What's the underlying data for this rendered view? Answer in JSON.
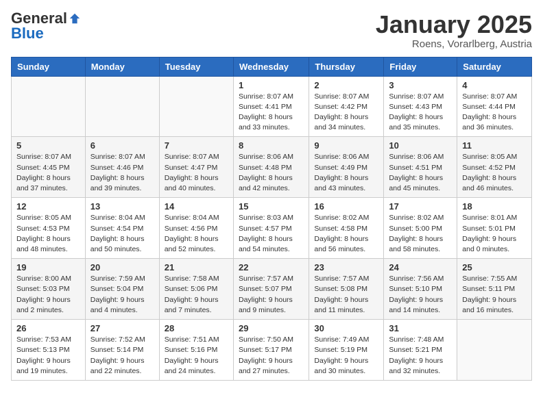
{
  "header": {
    "logo_general": "General",
    "logo_blue": "Blue",
    "title": "January 2025",
    "location": "Roens, Vorarlberg, Austria"
  },
  "weekdays": [
    "Sunday",
    "Monday",
    "Tuesday",
    "Wednesday",
    "Thursday",
    "Friday",
    "Saturday"
  ],
  "weeks": [
    [
      {
        "day": "",
        "info": ""
      },
      {
        "day": "",
        "info": ""
      },
      {
        "day": "",
        "info": ""
      },
      {
        "day": "1",
        "info": "Sunrise: 8:07 AM\nSunset: 4:41 PM\nDaylight: 8 hours\nand 33 minutes."
      },
      {
        "day": "2",
        "info": "Sunrise: 8:07 AM\nSunset: 4:42 PM\nDaylight: 8 hours\nand 34 minutes."
      },
      {
        "day": "3",
        "info": "Sunrise: 8:07 AM\nSunset: 4:43 PM\nDaylight: 8 hours\nand 35 minutes."
      },
      {
        "day": "4",
        "info": "Sunrise: 8:07 AM\nSunset: 4:44 PM\nDaylight: 8 hours\nand 36 minutes."
      }
    ],
    [
      {
        "day": "5",
        "info": "Sunrise: 8:07 AM\nSunset: 4:45 PM\nDaylight: 8 hours\nand 37 minutes."
      },
      {
        "day": "6",
        "info": "Sunrise: 8:07 AM\nSunset: 4:46 PM\nDaylight: 8 hours\nand 39 minutes."
      },
      {
        "day": "7",
        "info": "Sunrise: 8:07 AM\nSunset: 4:47 PM\nDaylight: 8 hours\nand 40 minutes."
      },
      {
        "day": "8",
        "info": "Sunrise: 8:06 AM\nSunset: 4:48 PM\nDaylight: 8 hours\nand 42 minutes."
      },
      {
        "day": "9",
        "info": "Sunrise: 8:06 AM\nSunset: 4:49 PM\nDaylight: 8 hours\nand 43 minutes."
      },
      {
        "day": "10",
        "info": "Sunrise: 8:06 AM\nSunset: 4:51 PM\nDaylight: 8 hours\nand 45 minutes."
      },
      {
        "day": "11",
        "info": "Sunrise: 8:05 AM\nSunset: 4:52 PM\nDaylight: 8 hours\nand 46 minutes."
      }
    ],
    [
      {
        "day": "12",
        "info": "Sunrise: 8:05 AM\nSunset: 4:53 PM\nDaylight: 8 hours\nand 48 minutes."
      },
      {
        "day": "13",
        "info": "Sunrise: 8:04 AM\nSunset: 4:54 PM\nDaylight: 8 hours\nand 50 minutes."
      },
      {
        "day": "14",
        "info": "Sunrise: 8:04 AM\nSunset: 4:56 PM\nDaylight: 8 hours\nand 52 minutes."
      },
      {
        "day": "15",
        "info": "Sunrise: 8:03 AM\nSunset: 4:57 PM\nDaylight: 8 hours\nand 54 minutes."
      },
      {
        "day": "16",
        "info": "Sunrise: 8:02 AM\nSunset: 4:58 PM\nDaylight: 8 hours\nand 56 minutes."
      },
      {
        "day": "17",
        "info": "Sunrise: 8:02 AM\nSunset: 5:00 PM\nDaylight: 8 hours\nand 58 minutes."
      },
      {
        "day": "18",
        "info": "Sunrise: 8:01 AM\nSunset: 5:01 PM\nDaylight: 9 hours\nand 0 minutes."
      }
    ],
    [
      {
        "day": "19",
        "info": "Sunrise: 8:00 AM\nSunset: 5:03 PM\nDaylight: 9 hours\nand 2 minutes."
      },
      {
        "day": "20",
        "info": "Sunrise: 7:59 AM\nSunset: 5:04 PM\nDaylight: 9 hours\nand 4 minutes."
      },
      {
        "day": "21",
        "info": "Sunrise: 7:58 AM\nSunset: 5:06 PM\nDaylight: 9 hours\nand 7 minutes."
      },
      {
        "day": "22",
        "info": "Sunrise: 7:57 AM\nSunset: 5:07 PM\nDaylight: 9 hours\nand 9 minutes."
      },
      {
        "day": "23",
        "info": "Sunrise: 7:57 AM\nSunset: 5:08 PM\nDaylight: 9 hours\nand 11 minutes."
      },
      {
        "day": "24",
        "info": "Sunrise: 7:56 AM\nSunset: 5:10 PM\nDaylight: 9 hours\nand 14 minutes."
      },
      {
        "day": "25",
        "info": "Sunrise: 7:55 AM\nSunset: 5:11 PM\nDaylight: 9 hours\nand 16 minutes."
      }
    ],
    [
      {
        "day": "26",
        "info": "Sunrise: 7:53 AM\nSunset: 5:13 PM\nDaylight: 9 hours\nand 19 minutes."
      },
      {
        "day": "27",
        "info": "Sunrise: 7:52 AM\nSunset: 5:14 PM\nDaylight: 9 hours\nand 22 minutes."
      },
      {
        "day": "28",
        "info": "Sunrise: 7:51 AM\nSunset: 5:16 PM\nDaylight: 9 hours\nand 24 minutes."
      },
      {
        "day": "29",
        "info": "Sunrise: 7:50 AM\nSunset: 5:17 PM\nDaylight: 9 hours\nand 27 minutes."
      },
      {
        "day": "30",
        "info": "Sunrise: 7:49 AM\nSunset: 5:19 PM\nDaylight: 9 hours\nand 30 minutes."
      },
      {
        "day": "31",
        "info": "Sunrise: 7:48 AM\nSunset: 5:21 PM\nDaylight: 9 hours\nand 32 minutes."
      },
      {
        "day": "",
        "info": ""
      }
    ]
  ]
}
